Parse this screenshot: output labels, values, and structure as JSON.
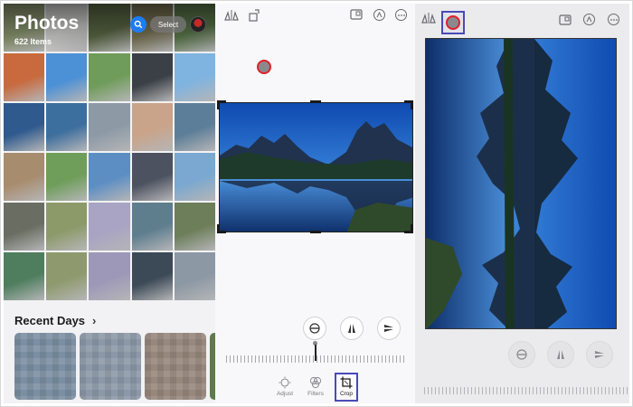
{
  "library": {
    "title": "Photos",
    "count": "622 Items",
    "select_label": "Select",
    "search_icon": "search-icon",
    "recent_days_label": "Recent Days",
    "chevron": "›",
    "tile_colors": [
      "#8d9a72",
      "#d8d8d6",
      "#5d6b46",
      "#7c7656",
      "#5c7a4c",
      "#c86a3e",
      "#4c90d6",
      "#6f9c5a",
      "#3a4046",
      "#7fb4e0",
      "#2e5a8e",
      "#3d6f9e",
      "#8d9aa6",
      "#c9a48a",
      "#5d7e98",
      "#a88c6e",
      "#6e9e5a",
      "#5c8ec4",
      "#4c5260",
      "#7aa8d0",
      "#6a6e62",
      "#8c9a6a",
      "#a9a3c4",
      "#5e7e8e",
      "#6c7e5a",
      "#4e7e5e",
      "#8e9a6e",
      "#9e98b8",
      "#3c4a58",
      "#8c98a4"
    ]
  },
  "editor": {
    "marker": "tap-marker",
    "tools": [
      "flip-horizontal-icon",
      "aspect-ratio-icon",
      "rotate-icon",
      "markup-icon",
      "more-icon"
    ],
    "bottom_tools": [
      "straighten-icon",
      "vertical-perspective-icon",
      "horizontal-perspective-icon"
    ],
    "tabs": [
      {
        "label": "Adjust",
        "icon": "adjust-icon"
      },
      {
        "label": "Filters",
        "icon": "filters-icon"
      },
      {
        "label": "Crop",
        "icon": "crop-icon"
      }
    ],
    "active_tab": "Crop"
  },
  "rotated": {
    "tools": [
      "flip-horizontal-icon",
      "rotate-icon",
      "aspect-ratio-icon",
      "markup-icon",
      "more-icon"
    ]
  },
  "colors": {
    "accent": "#1e7cf2",
    "marker_ring": "#e0202a",
    "highlight": "#4a4ab8"
  }
}
